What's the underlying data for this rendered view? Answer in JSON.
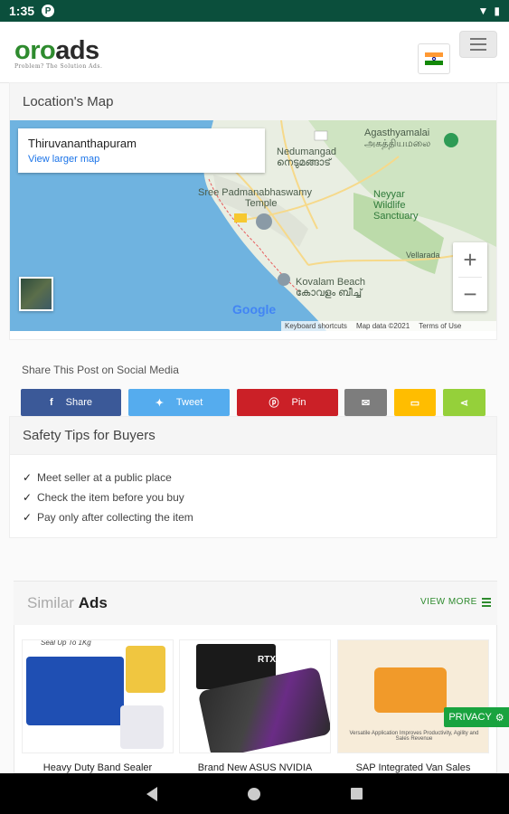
{
  "status_bar": {
    "time": "1:35",
    "notification_icon": "P"
  },
  "header": {
    "logo_oro": "oro",
    "logo_ads": "ads",
    "tagline": "Problem? The Solution Ads.",
    "flag_icon": "india-flag-icon"
  },
  "map": {
    "title": "Location's Map",
    "place_name": "Thiruvananthapuram",
    "view_larger": "View larger map",
    "labels": {
      "nedumangad": "Nedumangad",
      "nedumangad_ml": "നെടുമങ്ങാട്",
      "agasthyamalai": "Agasthyamalai",
      "agasthyamalai_ta": "அகத்தியமலை",
      "neyyar": "Neyyar",
      "wildlife": "Wildlife",
      "sanctuary": "Sanctuary",
      "sree": "Sree Padmanabhaswamy",
      "temple": "Temple",
      "vellarada": "Vellarada",
      "kovalam": "Kovalam Beach",
      "kovalam_ml": "കോവളം ബീച്ച്"
    },
    "google": "Google",
    "footer": {
      "shortcuts": "Keyboard shortcuts",
      "map_data": "Map data ©2021",
      "terms": "Terms of Use"
    },
    "zoom_in": "+",
    "zoom_out": "−"
  },
  "share": {
    "title": "Share This Post on Social Media",
    "facebook": "Share",
    "twitter": "Tweet",
    "pinterest": "Pin"
  },
  "safety": {
    "title": "Safety Tips for Buyers",
    "tips": [
      "Meet seller at a public place",
      "Check the item before you buy",
      "Pay only after collecting the item"
    ]
  },
  "similar": {
    "light": "Similar",
    "bold": "Ads",
    "view_more": "VIEW MORE",
    "ads": [
      {
        "title": "Heavy Duty Band Sealer",
        "top_text": "Seal Up To 1Kg"
      },
      {
        "title": "Brand New ASUS NVIDIA",
        "badge": "RTX"
      },
      {
        "title": "SAP Integrated Van Sales",
        "caption": "Versatile Application Improves Productivity, Agility and Sales Revenue"
      }
    ]
  },
  "privacy": "PRIVACY",
  "colors": {
    "brand_green": "#2e8b2e",
    "status_bar": "#0b4f3c",
    "facebook": "#3b5998",
    "twitter": "#55acee",
    "pinterest": "#cb2027",
    "email": "#7d7d7d",
    "sms": "#ffbd00",
    "sharethis": "#95d03a"
  }
}
